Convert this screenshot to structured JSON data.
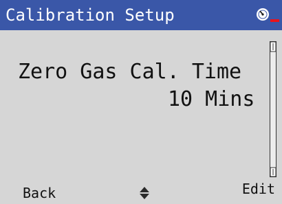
{
  "header": {
    "title": "Calibration Setup",
    "status_icon": "gauge-icon",
    "title_bar_color": "#3a57a8",
    "alert_color": "#e8141c"
  },
  "main": {
    "parameter_label": "Zero Gas Cal. Time",
    "parameter_value": "10 Mins"
  },
  "softkeys": {
    "left_label": "Back",
    "center_icon": "up-down-arrows-icon",
    "right_label": "Edit"
  },
  "colors": {
    "screen_background": "#d6d6d6",
    "text": "#111111"
  }
}
